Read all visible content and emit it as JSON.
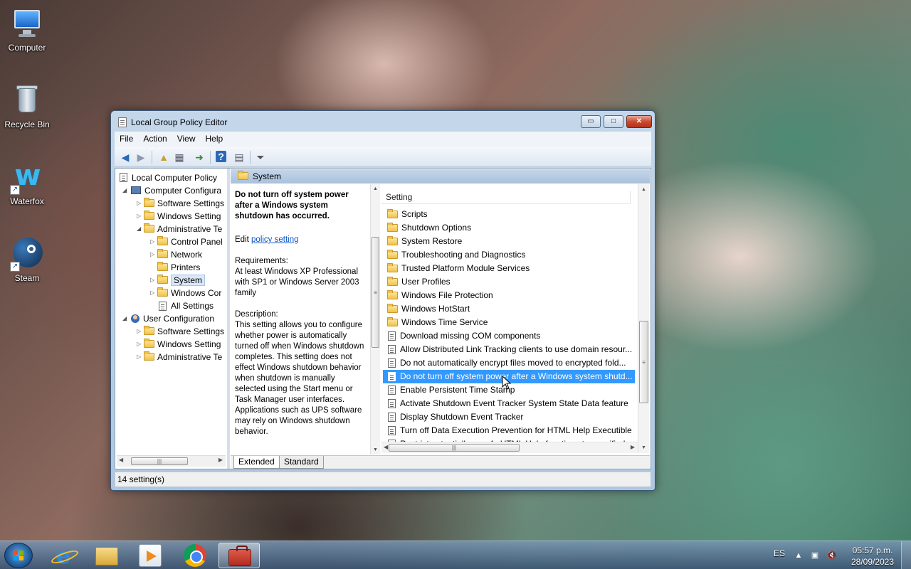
{
  "desktop": {
    "icons": [
      {
        "label": "Computer"
      },
      {
        "label": "Recycle Bin"
      },
      {
        "label": "Waterfox"
      },
      {
        "label": "Steam"
      }
    ]
  },
  "window": {
    "title": "Local Group Policy Editor",
    "controls": {
      "minimize": "▭",
      "maximize": "□",
      "close": "✕"
    },
    "menu": [
      "File",
      "Action",
      "View",
      "Help"
    ],
    "toolbar_icons": [
      "back-arrow-icon",
      "forward-arrow-icon",
      "up-folder-icon",
      "show-hide-tree-icon",
      "export-list-icon",
      "help-icon",
      "properties-icon",
      "filter-icon"
    ],
    "tree": [
      {
        "label": "Local Computer Policy",
        "expander": "",
        "indent": 0
      },
      {
        "label": "Computer Configura",
        "expander": "◢",
        "indent": 1
      },
      {
        "label": "Software Settings",
        "expander": "▷",
        "indent": 2
      },
      {
        "label": "Windows Setting",
        "expander": "▷",
        "indent": 2
      },
      {
        "label": "Administrative Te",
        "expander": "◢",
        "indent": 2
      },
      {
        "label": "Control Panel",
        "expander": "▷",
        "indent": 3
      },
      {
        "label": "Network",
        "expander": "▷",
        "indent": 3
      },
      {
        "label": "Printers",
        "expander": "",
        "indent": 3
      },
      {
        "label": "System",
        "expander": "▷",
        "indent": 3,
        "selected": true
      },
      {
        "label": "Windows Cor",
        "expander": "▷",
        "indent": 3
      },
      {
        "label": "All Settings",
        "expander": "",
        "indent": 3
      },
      {
        "label": "User Configuration",
        "expander": "◢",
        "indent": 1
      },
      {
        "label": "Software Settings",
        "expander": "▷",
        "indent": 2
      },
      {
        "label": "Windows Setting",
        "expander": "▷",
        "indent": 2
      },
      {
        "label": "Administrative Te",
        "expander": "▷",
        "indent": 2
      }
    ],
    "right_header": "System",
    "description": {
      "title": "Do not turn off system power after a Windows system shutdown has occurred.",
      "edit_prefix": "Edit",
      "edit_link": "policy setting",
      "requirements_label": "Requirements:",
      "requirements": "At least Windows XP Professional with SP1 or Windows Server 2003 family",
      "description_label": "Description:",
      "description": "This setting allows you to configure whether power is automatically turned off when Windows shutdown completes. This setting does not effect Windows shutdown behavior when shutdown is manually selected using the Start menu or Task Manager user interfaces. Applications such as UPS software may rely on Windows shutdown behavior."
    },
    "list_header": "Setting",
    "list": [
      {
        "label": "Scripts",
        "type": "folder"
      },
      {
        "label": "Shutdown Options",
        "type": "folder"
      },
      {
        "label": "System Restore",
        "type": "folder"
      },
      {
        "label": "Troubleshooting and Diagnostics",
        "type": "folder"
      },
      {
        "label": "Trusted Platform Module Services",
        "type": "folder"
      },
      {
        "label": "User Profiles",
        "type": "folder"
      },
      {
        "label": "Windows File Protection",
        "type": "folder"
      },
      {
        "label": "Windows HotStart",
        "type": "folder"
      },
      {
        "label": "Windows Time Service",
        "type": "folder"
      },
      {
        "label": "Download missing COM components",
        "type": "setting"
      },
      {
        "label": "Allow Distributed Link Tracking clients to use domain resour...",
        "type": "setting"
      },
      {
        "label": "Do not automatically encrypt files moved to encrypted fold...",
        "type": "setting"
      },
      {
        "label": "Do not turn off system power after a Windows system shutd...",
        "type": "setting",
        "selected": true
      },
      {
        "label": "Enable Persistent Time Stamp",
        "type": "setting"
      },
      {
        "label": "Activate Shutdown Event Tracker System State Data feature",
        "type": "setting"
      },
      {
        "label": "Display Shutdown Event Tracker",
        "type": "setting"
      },
      {
        "label": "Turn off Data Execution Prevention for HTML Help Executible",
        "type": "setting"
      },
      {
        "label": "Restrict potentially unsafe HTML Help functions to specified...",
        "type": "setting"
      }
    ],
    "tabs": [
      "Extended",
      "Standard"
    ],
    "status": "14 setting(s)"
  },
  "taskbar": {
    "apps": [
      "internet-explorer-icon",
      "file-explorer-icon",
      "media-player-icon",
      "chrome-icon",
      "group-policy-editor-icon"
    ],
    "language": "ES",
    "time": "05:57 p.m.",
    "date": "28/09/2023"
  }
}
